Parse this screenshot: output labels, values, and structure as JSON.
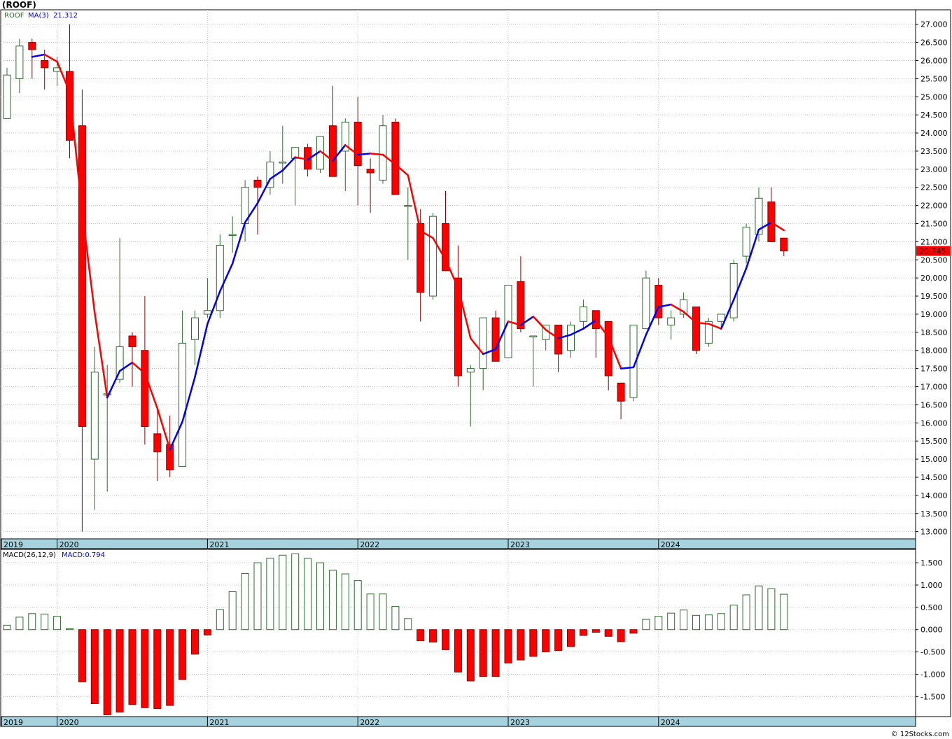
{
  "title": "(ROOF)",
  "copyright": "© 12Stocks.com",
  "colors": {
    "up": "#2e6b2e",
    "down": "#ff0000",
    "ma_up": "#0000ee",
    "ma_down": "#ff0000",
    "axis_band": "#a7d3df",
    "price_badge": "#ff0000"
  },
  "chart_data": [
    {
      "type": "candlestick",
      "legend": {
        "symbol": "ROOF",
        "ma_label": "MA(3)",
        "ma_value": "21.312"
      },
      "ylim": [
        12.8,
        27.4
      ],
      "yticks": [
        "13.000",
        "13.500",
        "14.000",
        "14.500",
        "15.000",
        "15.500",
        "16.000",
        "16.500",
        "17.000",
        "17.500",
        "18.000",
        "18.500",
        "19.000",
        "19.500",
        "20.000",
        "20.500",
        "21.000",
        "21.500",
        "22.000",
        "22.500",
        "23.000",
        "23.500",
        "24.000",
        "24.500",
        "25.000",
        "25.500",
        "26.000",
        "26.500",
        "27.000"
      ],
      "last_price": "20.745",
      "x_labels": [
        {
          "label": "2019",
          "index": -0.5
        },
        {
          "label": "2020",
          "index": 4
        },
        {
          "label": "2021",
          "index": 16
        },
        {
          "label": "2022",
          "index": 28
        },
        {
          "label": "2023",
          "index": 40
        },
        {
          "label": "2024",
          "index": 52
        }
      ],
      "candles": [
        {
          "o": 24.4,
          "h": 25.8,
          "l": 24.4,
          "c": 25.6
        },
        {
          "o": 25.5,
          "h": 26.6,
          "l": 25.1,
          "c": 26.4
        },
        {
          "o": 26.5,
          "h": 26.6,
          "l": 25.5,
          "c": 26.3
        },
        {
          "o": 26.0,
          "h": 26.3,
          "l": 25.2,
          "c": 25.8
        },
        {
          "o": 25.7,
          "h": 26.1,
          "l": 25.3,
          "c": 25.8
        },
        {
          "o": 25.7,
          "h": 27.0,
          "l": 23.3,
          "c": 23.8
        },
        {
          "o": 24.2,
          "h": 25.2,
          "l": 13.0,
          "c": 15.9
        },
        {
          "o": 15.0,
          "h": 18.1,
          "l": 13.6,
          "c": 17.4
        },
        {
          "o": 16.8,
          "h": 17.6,
          "l": 14.1,
          "c": 16.8
        },
        {
          "o": 17.2,
          "h": 21.1,
          "l": 17.1,
          "c": 18.1
        },
        {
          "o": 18.4,
          "h": 18.5,
          "l": 17.0,
          "c": 18.1
        },
        {
          "o": 18.0,
          "h": 19.5,
          "l": 15.4,
          "c": 15.9
        },
        {
          "o": 15.7,
          "h": 16.4,
          "l": 14.4,
          "c": 15.2
        },
        {
          "o": 15.4,
          "h": 16.2,
          "l": 14.5,
          "c": 14.7
        },
        {
          "o": 14.8,
          "h": 19.1,
          "l": 14.8,
          "c": 18.2
        },
        {
          "o": 18.3,
          "h": 19.1,
          "l": 17.6,
          "c": 18.9
        },
        {
          "o": 19.0,
          "h": 20.0,
          "l": 18.9,
          "c": 19.1
        },
        {
          "o": 19.1,
          "h": 21.2,
          "l": 18.9,
          "c": 20.9
        },
        {
          "o": 21.2,
          "h": 21.7,
          "l": 20.7,
          "c": 21.2
        },
        {
          "o": 21.5,
          "h": 22.7,
          "l": 21.0,
          "c": 22.5
        },
        {
          "o": 22.7,
          "h": 22.8,
          "l": 21.2,
          "c": 22.5
        },
        {
          "o": 22.5,
          "h": 23.5,
          "l": 22.3,
          "c": 23.2
        },
        {
          "o": 23.2,
          "h": 24.2,
          "l": 22.6,
          "c": 23.2
        },
        {
          "o": 23.3,
          "h": 23.6,
          "l": 22.0,
          "c": 23.6
        },
        {
          "o": 23.6,
          "h": 23.7,
          "l": 22.8,
          "c": 23.0
        },
        {
          "o": 23.0,
          "h": 23.9,
          "l": 22.9,
          "c": 23.9
        },
        {
          "o": 24.2,
          "h": 25.3,
          "l": 22.8,
          "c": 22.8
        },
        {
          "o": 23.5,
          "h": 24.4,
          "l": 22.4,
          "c": 24.3
        },
        {
          "o": 24.3,
          "h": 25.0,
          "l": 22.0,
          "c": 23.1
        },
        {
          "o": 23.0,
          "h": 23.3,
          "l": 21.8,
          "c": 22.9
        },
        {
          "o": 22.7,
          "h": 24.5,
          "l": 22.6,
          "c": 24.2
        },
        {
          "o": 24.3,
          "h": 24.4,
          "l": 22.3,
          "c": 22.3
        },
        {
          "o": 22.0,
          "h": 22.5,
          "l": 20.5,
          "c": 22.0
        },
        {
          "o": 21.5,
          "h": 21.9,
          "l": 18.8,
          "c": 19.6
        },
        {
          "o": 19.5,
          "h": 21.8,
          "l": 19.4,
          "c": 21.7
        },
        {
          "o": 21.5,
          "h": 22.4,
          "l": 20.2,
          "c": 20.2
        },
        {
          "o": 20.0,
          "h": 20.9,
          "l": 17.0,
          "c": 17.3
        },
        {
          "o": 17.4,
          "h": 17.6,
          "l": 15.9,
          "c": 17.5
        },
        {
          "o": 17.5,
          "h": 18.9,
          "l": 16.9,
          "c": 18.9
        },
        {
          "o": 18.9,
          "h": 19.1,
          "l": 17.7,
          "c": 17.7
        },
        {
          "o": 17.8,
          "h": 19.8,
          "l": 17.8,
          "c": 19.8
        },
        {
          "o": 19.9,
          "h": 20.6,
          "l": 18.5,
          "c": 18.6
        },
        {
          "o": 18.4,
          "h": 18.4,
          "l": 17.0,
          "c": 18.4
        },
        {
          "o": 18.3,
          "h": 18.7,
          "l": 18.0,
          "c": 18.7
        },
        {
          "o": 18.7,
          "h": 18.7,
          "l": 17.4,
          "c": 17.9
        },
        {
          "o": 18.0,
          "h": 18.8,
          "l": 17.8,
          "c": 18.7
        },
        {
          "o": 18.8,
          "h": 19.4,
          "l": 18.6,
          "c": 19.2
        },
        {
          "o": 19.1,
          "h": 19.1,
          "l": 17.8,
          "c": 18.6
        },
        {
          "o": 18.8,
          "h": 18.8,
          "l": 16.9,
          "c": 17.3
        },
        {
          "o": 17.1,
          "h": 17.1,
          "l": 16.1,
          "c": 16.6
        },
        {
          "o": 16.7,
          "h": 18.7,
          "l": 16.6,
          "c": 18.7
        },
        {
          "o": 18.6,
          "h": 20.2,
          "l": 18.6,
          "c": 20.0
        },
        {
          "o": 19.8,
          "h": 20.0,
          "l": 18.7,
          "c": 18.9
        },
        {
          "o": 18.7,
          "h": 19.1,
          "l": 18.3,
          "c": 18.9
        },
        {
          "o": 19.0,
          "h": 19.6,
          "l": 18.9,
          "c": 19.4
        },
        {
          "o": 19.2,
          "h": 19.2,
          "l": 17.9,
          "c": 18.0
        },
        {
          "o": 18.2,
          "h": 18.9,
          "l": 18.1,
          "c": 18.8
        },
        {
          "o": 18.8,
          "h": 19.0,
          "l": 18.6,
          "c": 19.0
        },
        {
          "o": 18.9,
          "h": 20.5,
          "l": 18.8,
          "c": 20.4
        },
        {
          "o": 20.6,
          "h": 21.5,
          "l": 20.4,
          "c": 21.4
        },
        {
          "o": 21.2,
          "h": 22.5,
          "l": 21.0,
          "c": 22.2
        },
        {
          "o": 22.1,
          "h": 22.5,
          "l": 21.0,
          "c": 21.0
        },
        {
          "o": 21.1,
          "h": 21.1,
          "l": 20.6,
          "c": 20.745
        }
      ]
    },
    {
      "type": "bar",
      "legend": {
        "label": "MACD(26,12,9)",
        "value_label": "MACD:0.794"
      },
      "ylim": [
        -1.95,
        1.8
      ],
      "yticks": [
        "1.500",
        "1.000",
        "0.500",
        "0.000",
        "-0.500",
        "-1.000",
        "-1.500"
      ],
      "values": [
        0.1,
        0.28,
        0.36,
        0.35,
        0.3,
        0.02,
        -1.17,
        -1.66,
        -1.91,
        -1.85,
        -1.68,
        -1.75,
        -1.77,
        -1.7,
        -1.12,
        -0.55,
        -0.12,
        0.45,
        0.85,
        1.26,
        1.5,
        1.6,
        1.67,
        1.7,
        1.6,
        1.5,
        1.33,
        1.25,
        1.1,
        0.8,
        0.8,
        0.52,
        0.25,
        -0.25,
        -0.28,
        -0.45,
        -0.95,
        -1.15,
        -1.05,
        -1.05,
        -0.75,
        -0.68,
        -0.6,
        -0.5,
        -0.47,
        -0.38,
        -0.13,
        -0.06,
        -0.15,
        -0.27,
        -0.08,
        0.23,
        0.3,
        0.37,
        0.44,
        0.32,
        0.33,
        0.36,
        0.55,
        0.78,
        0.98,
        0.92,
        0.794
      ]
    }
  ]
}
